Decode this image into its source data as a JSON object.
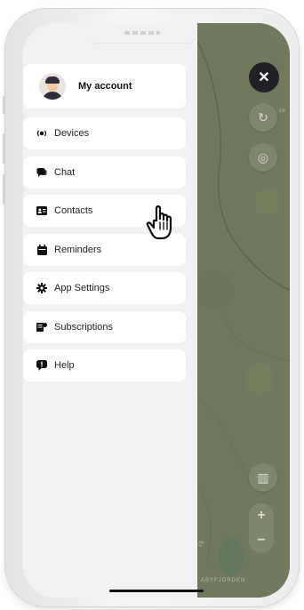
{
  "menu": {
    "account": {
      "label": "My account",
      "avatar_icon": "user-avatar"
    },
    "items": [
      {
        "label": "Devices",
        "icon": "devices-icon"
      },
      {
        "label": "Chat",
        "icon": "chat-icon"
      },
      {
        "label": "Contacts",
        "icon": "contacts-icon"
      },
      {
        "label": "Reminders",
        "icon": "calendar-icon"
      },
      {
        "label": "App Settings",
        "icon": "gear-icon"
      },
      {
        "label": "Subscriptions",
        "icon": "subscriptions-icon"
      },
      {
        "label": "Help",
        "icon": "help-icon"
      }
    ]
  },
  "map": {
    "close_icon": "close-icon",
    "refresh_icon": "refresh-icon",
    "locate_icon": "locate-icon",
    "map_type_icon": "map-type-icon",
    "zoom_in_label": "+",
    "zoom_out_label": "−",
    "partial_label_top": "sk",
    "region_label": "ABYFJORDEN",
    "partial_label_bottom": "is"
  },
  "colors": {
    "map_bg": "#6e7a5b",
    "drawer_bg": "#f1f1f1",
    "card_bg": "#ffffff",
    "close_button_bg": "#1f2124"
  }
}
